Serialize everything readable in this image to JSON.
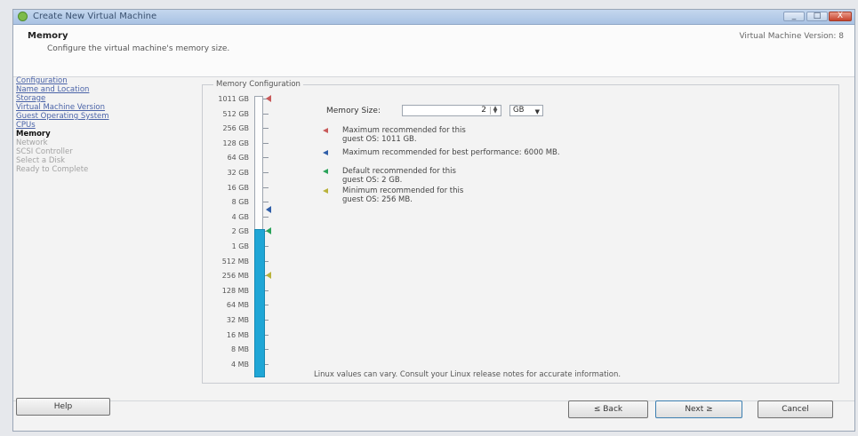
{
  "window": {
    "title": "Create New Virtual Machine",
    "buttons": {
      "minimize": "_",
      "maximize": "□",
      "close": "X"
    }
  },
  "header": {
    "title": "Memory",
    "subtitle": "Configure the virtual machine's memory size.",
    "version": "Virtual Machine Version: 8"
  },
  "steps": [
    {
      "label": "Configuration",
      "state": "done"
    },
    {
      "label": "Name and Location",
      "state": "done"
    },
    {
      "label": "Storage",
      "state": "done"
    },
    {
      "label": "Virtual Machine Version",
      "state": "done"
    },
    {
      "label": "Guest Operating System",
      "state": "done"
    },
    {
      "label": "CPUs",
      "state": "done"
    },
    {
      "label": "Memory",
      "state": "current"
    },
    {
      "label": "Network",
      "state": "pending"
    },
    {
      "label": "SCSI Controller",
      "state": "pending"
    },
    {
      "label": "Select a Disk",
      "state": "pending"
    },
    {
      "label": "Ready to Complete",
      "state": "pending"
    }
  ],
  "memory_config": {
    "group_label": "Memory Configuration",
    "scale_labels": [
      "1011 GB",
      "512 GB",
      "256 GB",
      "128 GB",
      "64 GB",
      "32 GB",
      "16 GB",
      "8 GB",
      "4 GB",
      "2 GB",
      "1 GB",
      "512 MB",
      "256 MB",
      "128 MB",
      "64 MB",
      "32 MB",
      "16 MB",
      "8 MB",
      "4 MB"
    ],
    "current_value_label": "2 GB",
    "memory_size_label": "Memory Size:",
    "memory_size_value": "2",
    "unit_options": [
      "GB"
    ],
    "unit_selected": "GB",
    "legend": [
      {
        "color": "#c85a5a",
        "text_1": "Maximum recommended for this",
        "text_2": "guest OS: 1011 GB.",
        "at_label": "1011 GB"
      },
      {
        "color": "#2f5ea8",
        "text_1": "Maximum recommended for best performance: 6000 MB.",
        "text_2": "",
        "at_label": "6000 MB"
      },
      {
        "color": "#2aa35a",
        "text_1": "Default recommended for this",
        "text_2": "guest OS: 2 GB.",
        "at_label": "2 GB"
      },
      {
        "color": "#b9b23a",
        "text_1": "Minimum recommended for this",
        "text_2": "guest OS: 256 MB.",
        "at_label": "256 MB"
      }
    ],
    "note": "Linux values can vary. Consult your Linux release notes for accurate information."
  },
  "footer": {
    "help": "Help",
    "back": "≤ Back",
    "next": "Next ≥",
    "cancel": "Cancel"
  }
}
